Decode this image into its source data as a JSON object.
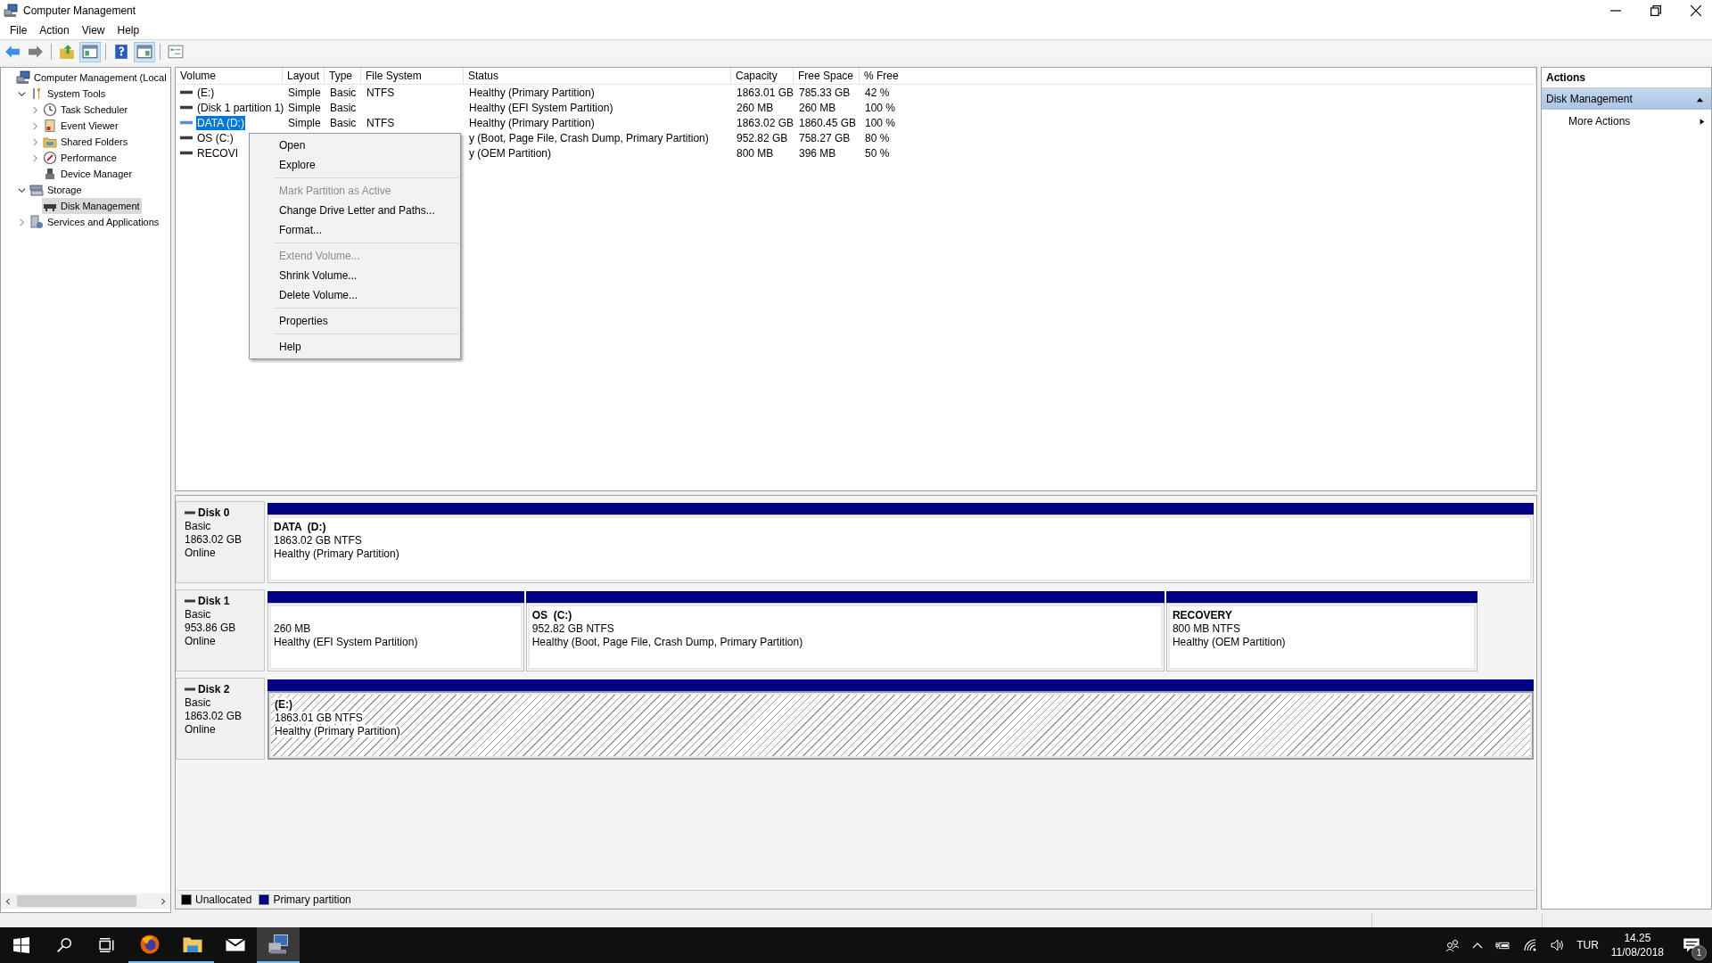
{
  "window": {
    "title": "Computer Management"
  },
  "menu": [
    "File",
    "Action",
    "View",
    "Help"
  ],
  "toolbar": [
    {
      "pressed": false
    },
    {
      "pressed": false
    },
    {
      "pressed": false
    },
    {
      "pressed": true
    },
    {
      "pressed": false
    },
    {
      "pressed": true
    },
    {
      "pressed": false
    }
  ],
  "tree": [
    {
      "label": "Computer Management (Local",
      "selected": false,
      "children": [
        {
          "label": "System Tools",
          "expanded": true,
          "selected": false,
          "children": [
            {
              "label": "Task Scheduler",
              "expanded": false,
              "selected": false
            },
            {
              "label": "Event Viewer",
              "expanded": false,
              "selected": false
            },
            {
              "label": "Shared Folders",
              "expanded": false,
              "selected": false
            },
            {
              "label": "Performance",
              "expanded": false,
              "selected": false
            },
            {
              "label": "Device Manager",
              "selected": false
            }
          ]
        },
        {
          "label": "Storage",
          "expanded": true,
          "selected": false,
          "children": [
            {
              "label": "Disk Management",
              "selected": true
            }
          ]
        },
        {
          "label": "Services and Applications",
          "expanded": false,
          "selected": false
        }
      ]
    }
  ],
  "table": {
    "columns": [
      "Volume",
      "Layout",
      "Type",
      "File System",
      "Status",
      "Capacity",
      "Free Space",
      "% Free"
    ],
    "rows": [
      {
        "volume": "(E:)",
        "layout": "Simple",
        "type": "Basic",
        "file_system": "NTFS",
        "status": "Healthy (Primary Partition)",
        "capacity": "1863.01 GB",
        "free_space": "785.33 GB",
        "percent_free": "42 %",
        "selected": false
      },
      {
        "volume": "(Disk 1 partition 1)",
        "layout": "Simple",
        "type": "Basic",
        "status": "Healthy (EFI System Partition)",
        "capacity": "260 MB",
        "free_space": "260 MB",
        "percent_free": "100 %",
        "selected": false
      },
      {
        "volume": "DATA (D:)",
        "layout": "Simple",
        "type": "Basic",
        "file_system": "NTFS",
        "status": "Healthy (Primary Partition)",
        "capacity": "1863.02 GB",
        "free_space": "1860.45 GB",
        "percent_free": "100 %",
        "selected": true
      },
      {
        "volume": "OS (C:)",
        "status": "y (Boot, Page File, Crash Dump, Primary Partition)",
        "capacity": "952.82 GB",
        "free_space": "758.27 GB",
        "percent_free": "80 %",
        "selected": false
      },
      {
        "volume": "RECOVI",
        "status": "y (OEM Partition)",
        "capacity": "800 MB",
        "free_space": "396 MB",
        "percent_free": "50 %",
        "selected": false
      }
    ]
  },
  "context_menu": {
    "items": [
      {
        "kind": "item",
        "label": "Open",
        "disabled": false
      },
      {
        "kind": "item",
        "label": "Explore",
        "disabled": false
      },
      {
        "kind": "separator"
      },
      {
        "kind": "item",
        "label": "Mark Partition as Active",
        "disabled": true
      },
      {
        "kind": "item",
        "label": "Change Drive Letter and Paths...",
        "disabled": false
      },
      {
        "kind": "item",
        "label": "Format...",
        "disabled": false
      },
      {
        "kind": "separator"
      },
      {
        "kind": "item",
        "label": "Extend Volume...",
        "disabled": true
      },
      {
        "kind": "item",
        "label": "Shrink Volume...",
        "disabled": false
      },
      {
        "kind": "item",
        "label": "Delete Volume...",
        "disabled": false
      },
      {
        "kind": "separator"
      },
      {
        "kind": "item",
        "label": "Properties",
        "disabled": false
      },
      {
        "kind": "separator"
      },
      {
        "kind": "item",
        "label": "Help",
        "disabled": false
      }
    ]
  },
  "disks": [
    {
      "name": "Disk 0",
      "type": "Basic",
      "size": "1863.02 GB",
      "status": "Online",
      "partitions": [
        {
          "label": "DATA  (D:)",
          "size": "1863.02 GB NTFS",
          "status": "Healthy (Primary Partition)",
          "selected": false
        }
      ]
    },
    {
      "name": "Disk 1",
      "type": "Basic",
      "size": "953.86 GB",
      "status": "Online",
      "partitions": [
        {
          "size": "260 MB",
          "status": "Healthy (EFI System Partition)",
          "selected": false
        },
        {
          "label": "OS  (C:)",
          "size": "952.82 GB NTFS",
          "status": "Healthy (Boot, Page File, Crash Dump, Primary Partition)",
          "selected": false
        },
        {
          "label": "RECOVERY",
          "size": "800 MB NTFS",
          "status": "Healthy (OEM Partition)",
          "selected": false
        }
      ]
    },
    {
      "name": "Disk 2",
      "type": "Basic",
      "size": "1863.02 GB",
      "status": "Online",
      "partitions": [
        {
          "label": "(E:)",
          "size": "1863.01 GB NTFS",
          "status": "Healthy (Primary Partition)",
          "selected": true
        }
      ]
    }
  ],
  "legend": [
    {
      "label": "Unallocated",
      "color": "#000000"
    },
    {
      "label": "Primary partition",
      "color": "#000080"
    }
  ],
  "actions": {
    "title": "Actions",
    "sections": [
      {
        "label": "Disk Management",
        "expanded": true,
        "items": [
          "More Actions"
        ]
      }
    ]
  },
  "taskbar": {
    "apps": [
      {
        "running": true,
        "selected": false
      },
      {
        "running": true,
        "selected": false
      },
      {
        "running": false,
        "selected": false
      },
      {
        "running": true,
        "selected": true
      }
    ],
    "language": "TUR",
    "time": "14.25",
    "date": "11/08/2018",
    "notifications": "1"
  }
}
